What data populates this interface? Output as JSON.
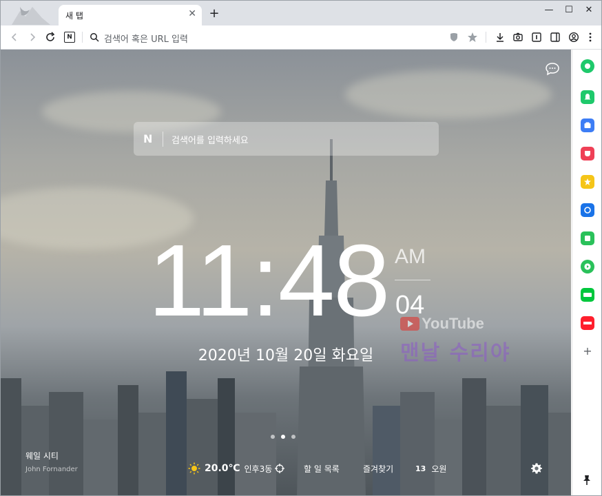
{
  "window": {
    "tab_title": "새 탭",
    "tab_close": "✕",
    "new_tab": "+",
    "minimize": "—",
    "maximize": "☐",
    "close": "✕"
  },
  "toolbar": {
    "address_placeholder": "검색어 혹은 URL 입력",
    "naver_badge": "N"
  },
  "search": {
    "logo": "N",
    "placeholder": "검색어를 입력하세요"
  },
  "clock": {
    "time": "11:48",
    "ampm": "AM",
    "seconds": "04",
    "date": "2020년 10월 20일 화요일"
  },
  "background": {
    "city": "웨일 시티",
    "credit": "John Fornander",
    "active_slide": 2,
    "slide_count": 3
  },
  "watermark": {
    "youtube": "YouTube",
    "channel": "맨날 수리야"
  },
  "bottom_bar": {
    "temperature": "20.0℃",
    "location": "인후3동",
    "todo": "할 일 목록",
    "bookmarks": "즐겨찾기",
    "count": "13",
    "task_label": "오원"
  },
  "sidebar": {
    "items": [
      {
        "icon": "whale-home-icon",
        "color": "#1ec96b"
      },
      {
        "icon": "notification-icon",
        "color": "#1ec96b"
      },
      {
        "icon": "store-icon",
        "color": "#3d7df5"
      },
      {
        "icon": "pocket-icon",
        "color": "#ef4056"
      },
      {
        "icon": "star-icon",
        "color": "#f5c518"
      },
      {
        "icon": "translate-icon",
        "color": "#1a73e8"
      },
      {
        "icon": "memo-icon",
        "color": "#2ac15a"
      },
      {
        "icon": "player-icon",
        "color": "#2ac15a"
      },
      {
        "icon": "webtoon-icon",
        "color": "#00c73c"
      },
      {
        "icon": "now-icon",
        "color": "#ff1f2d"
      }
    ],
    "add": "+"
  },
  "colors": {
    "accent": "#1ec96b",
    "sun": "#f5c518"
  }
}
